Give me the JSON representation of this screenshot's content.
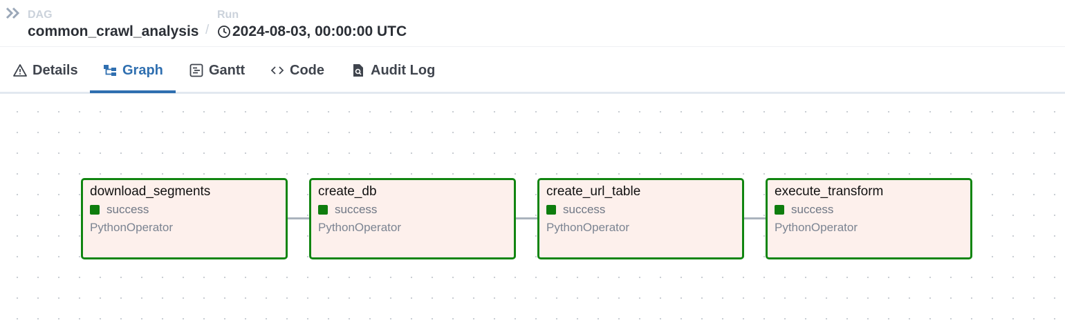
{
  "header": {
    "dag_label": "DAG",
    "dag_name": "common_crawl_analysis",
    "separator": "/",
    "run_label": "Run",
    "run_value": "2024-08-03, 00:00:00 UTC"
  },
  "tabs": [
    {
      "label": "Details",
      "icon": "warning-triangle-icon",
      "active": false
    },
    {
      "label": "Graph",
      "icon": "graph-icon",
      "active": true
    },
    {
      "label": "Gantt",
      "icon": "gantt-icon",
      "active": false
    },
    {
      "label": "Code",
      "icon": "code-icon",
      "active": false
    },
    {
      "label": "Audit Log",
      "icon": "audit-log-icon",
      "active": false
    }
  ],
  "colors": {
    "accent": "#2f6fb0",
    "success": "#0e7d0e",
    "node_border": "#108510",
    "node_bg": "#fdf0ec",
    "edge": "#aab3bd"
  },
  "graph": {
    "nodes": [
      {
        "task_id": "download_segments",
        "status": "success",
        "operator": "PythonOperator"
      },
      {
        "task_id": "create_db",
        "status": "success",
        "operator": "PythonOperator"
      },
      {
        "task_id": "create_url_table",
        "status": "success",
        "operator": "PythonOperator"
      },
      {
        "task_id": "execute_transform",
        "status": "success",
        "operator": "PythonOperator"
      }
    ]
  }
}
